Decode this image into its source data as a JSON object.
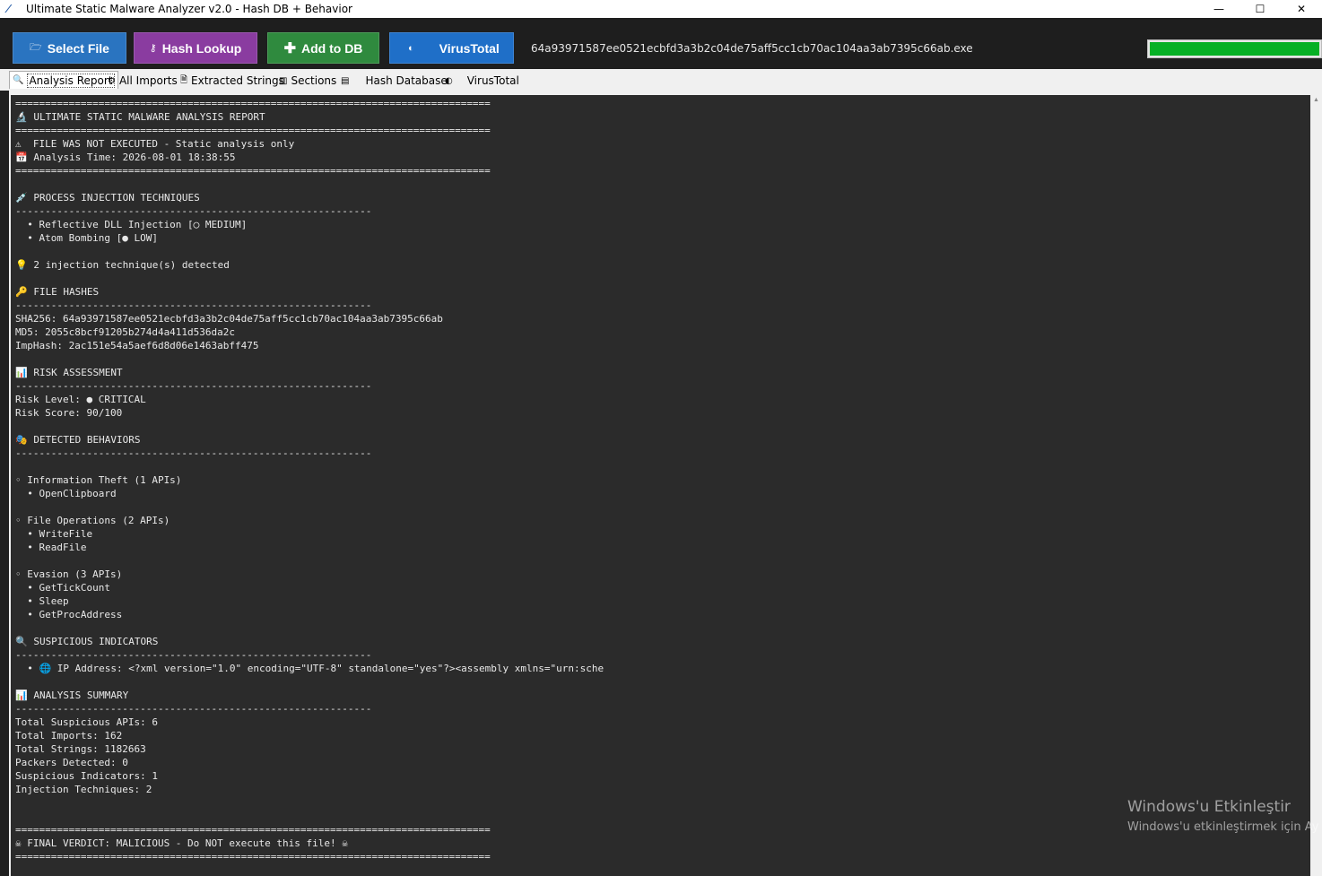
{
  "window": {
    "title": "Ultimate Static Malware Analyzer v2.0 - Hash DB + Behavior",
    "controls": {
      "minimize": "—",
      "maximize": "☐",
      "close": "✕"
    }
  },
  "toolbar": {
    "select_file": {
      "label": "Select File",
      "icon": "folder-icon",
      "color": "#2a74c0"
    },
    "hash_lookup": {
      "label": "Hash Lookup",
      "icon": "key-icon",
      "color": "#8a3ca0"
    },
    "add_to_db": {
      "label": "Add to DB",
      "icon": "plus-icon",
      "color": "#2f8a3e"
    },
    "virustotal": {
      "label": "VirusTotal",
      "icon": "globe-icon",
      "color": "#1f6fc8"
    },
    "filename": "64a93971587ee0521ecbfd3a3b2c04de75aff5cc1cb70ac104aa3ab7395c66ab.exe",
    "progress": 1.0,
    "progress_color": "#06b025"
  },
  "tabs": [
    {
      "label": "Analysis Report",
      "icon": "magnifier-icon",
      "active": true
    },
    {
      "label": "All Imports",
      "icon": "gear-icon",
      "active": false
    },
    {
      "label": "Extracted Strings",
      "icon": "document-icon",
      "active": false
    },
    {
      "label": "Sections",
      "icon": "chart-icon",
      "active": false
    },
    {
      "label": "Hash Database",
      "icon": "clipboard-icon",
      "active": false
    },
    {
      "label": "VirusTotal",
      "icon": "globe-icon",
      "active": false
    }
  ],
  "report": {
    "lines": [
      "================================================================================",
      "🔬 ULTIMATE STATIC MALWARE ANALYSIS REPORT",
      "================================================================================",
      "⚠  FILE WAS NOT EXECUTED - Static analysis only",
      "📅 Analysis Time: 2026-08-01 18:38:55",
      "================================================================================",
      "",
      "💉 PROCESS INJECTION TECHNIQUES",
      "------------------------------------------------------------",
      "  • Reflective DLL Injection [◯ MEDIUM]",
      "  • Atom Bombing [● LOW]",
      "",
      "💡 2 injection technique(s) detected",
      "",
      "🔑 FILE HASHES",
      "------------------------------------------------------------",
      "SHA256: 64a93971587ee0521ecbfd3a3b2c04de75aff5cc1cb70ac104aa3ab7395c66ab",
      "MD5: 2055c8bcf91205b274d4a411d536da2c",
      "ImpHash: 2ac151e54a5aef6d8d06e1463abff475",
      "",
      "📊 RISK ASSESSMENT",
      "------------------------------------------------------------",
      "Risk Level: ● CRITICAL",
      "Risk Score: 90/100",
      "",
      "🎭 DETECTED BEHAVIORS",
      "------------------------------------------------------------",
      "",
      "◦ Information Theft (1 APIs)",
      "  • OpenClipboard",
      "",
      "◦ File Operations (2 APIs)",
      "  • WriteFile",
      "  • ReadFile",
      "",
      "◦ Evasion (3 APIs)",
      "  • GetTickCount",
      "  • Sleep",
      "  • GetProcAddress",
      "",
      "🔍 SUSPICIOUS INDICATORS",
      "------------------------------------------------------------",
      "  • 🌐 IP Address: <?xml version=\"1.0\" encoding=\"UTF-8\" standalone=\"yes\"?><assembly xmlns=\"urn:sche",
      "",
      "📊 ANALYSIS SUMMARY",
      "------------------------------------------------------------",
      "Total Suspicious APIs: 6",
      "Total Imports: 162",
      "Total Strings: 1182663",
      "Packers Detected: 0",
      "Suspicious Indicators: 1",
      "Injection Techniques: 2",
      "",
      "",
      "================================================================================",
      "☠ FINAL VERDICT: MALICIOUS - Do NOT execute this file! ☠",
      "================================================================================"
    ]
  },
  "watermark": {
    "line1": "Windows'u Etkinleştir",
    "line2": "Windows'u etkinleştirmek için Ay"
  }
}
